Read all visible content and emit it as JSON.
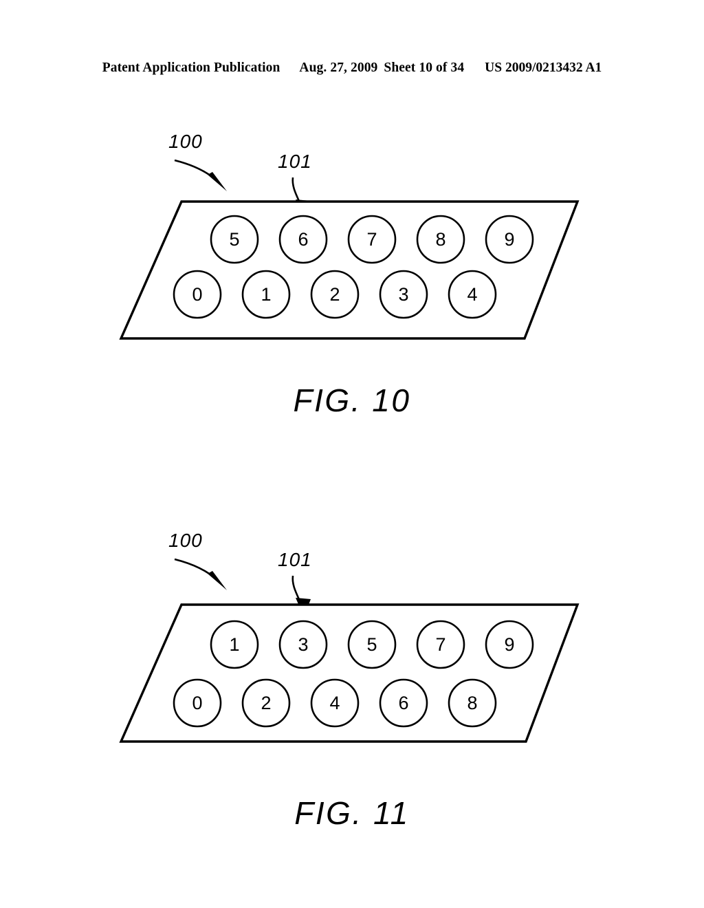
{
  "header": {
    "publication": "Patent Application Publication",
    "date": "Aug. 27, 2009",
    "sheet": "Sheet 10 of 34",
    "patent_number": "US 2009/0213432 A1"
  },
  "figures": [
    {
      "id": "fig-10",
      "caption": "FIG. 10",
      "callouts": {
        "plate": "100",
        "nozzle": "101"
      },
      "rows": {
        "top": [
          "5",
          "6",
          "7",
          "8",
          "9"
        ],
        "bottom": [
          "0",
          "1",
          "2",
          "3",
          "4"
        ]
      }
    },
    {
      "id": "fig-11",
      "caption": "FIG. 11",
      "callouts": {
        "plate": "100",
        "nozzle": "101"
      },
      "rows": {
        "top": [
          "1",
          "3",
          "5",
          "7",
          "9"
        ],
        "bottom": [
          "0",
          "2",
          "4",
          "6",
          "8"
        ]
      }
    }
  ],
  "colors": {
    "ink": "#000000",
    "paper": "#ffffff"
  }
}
